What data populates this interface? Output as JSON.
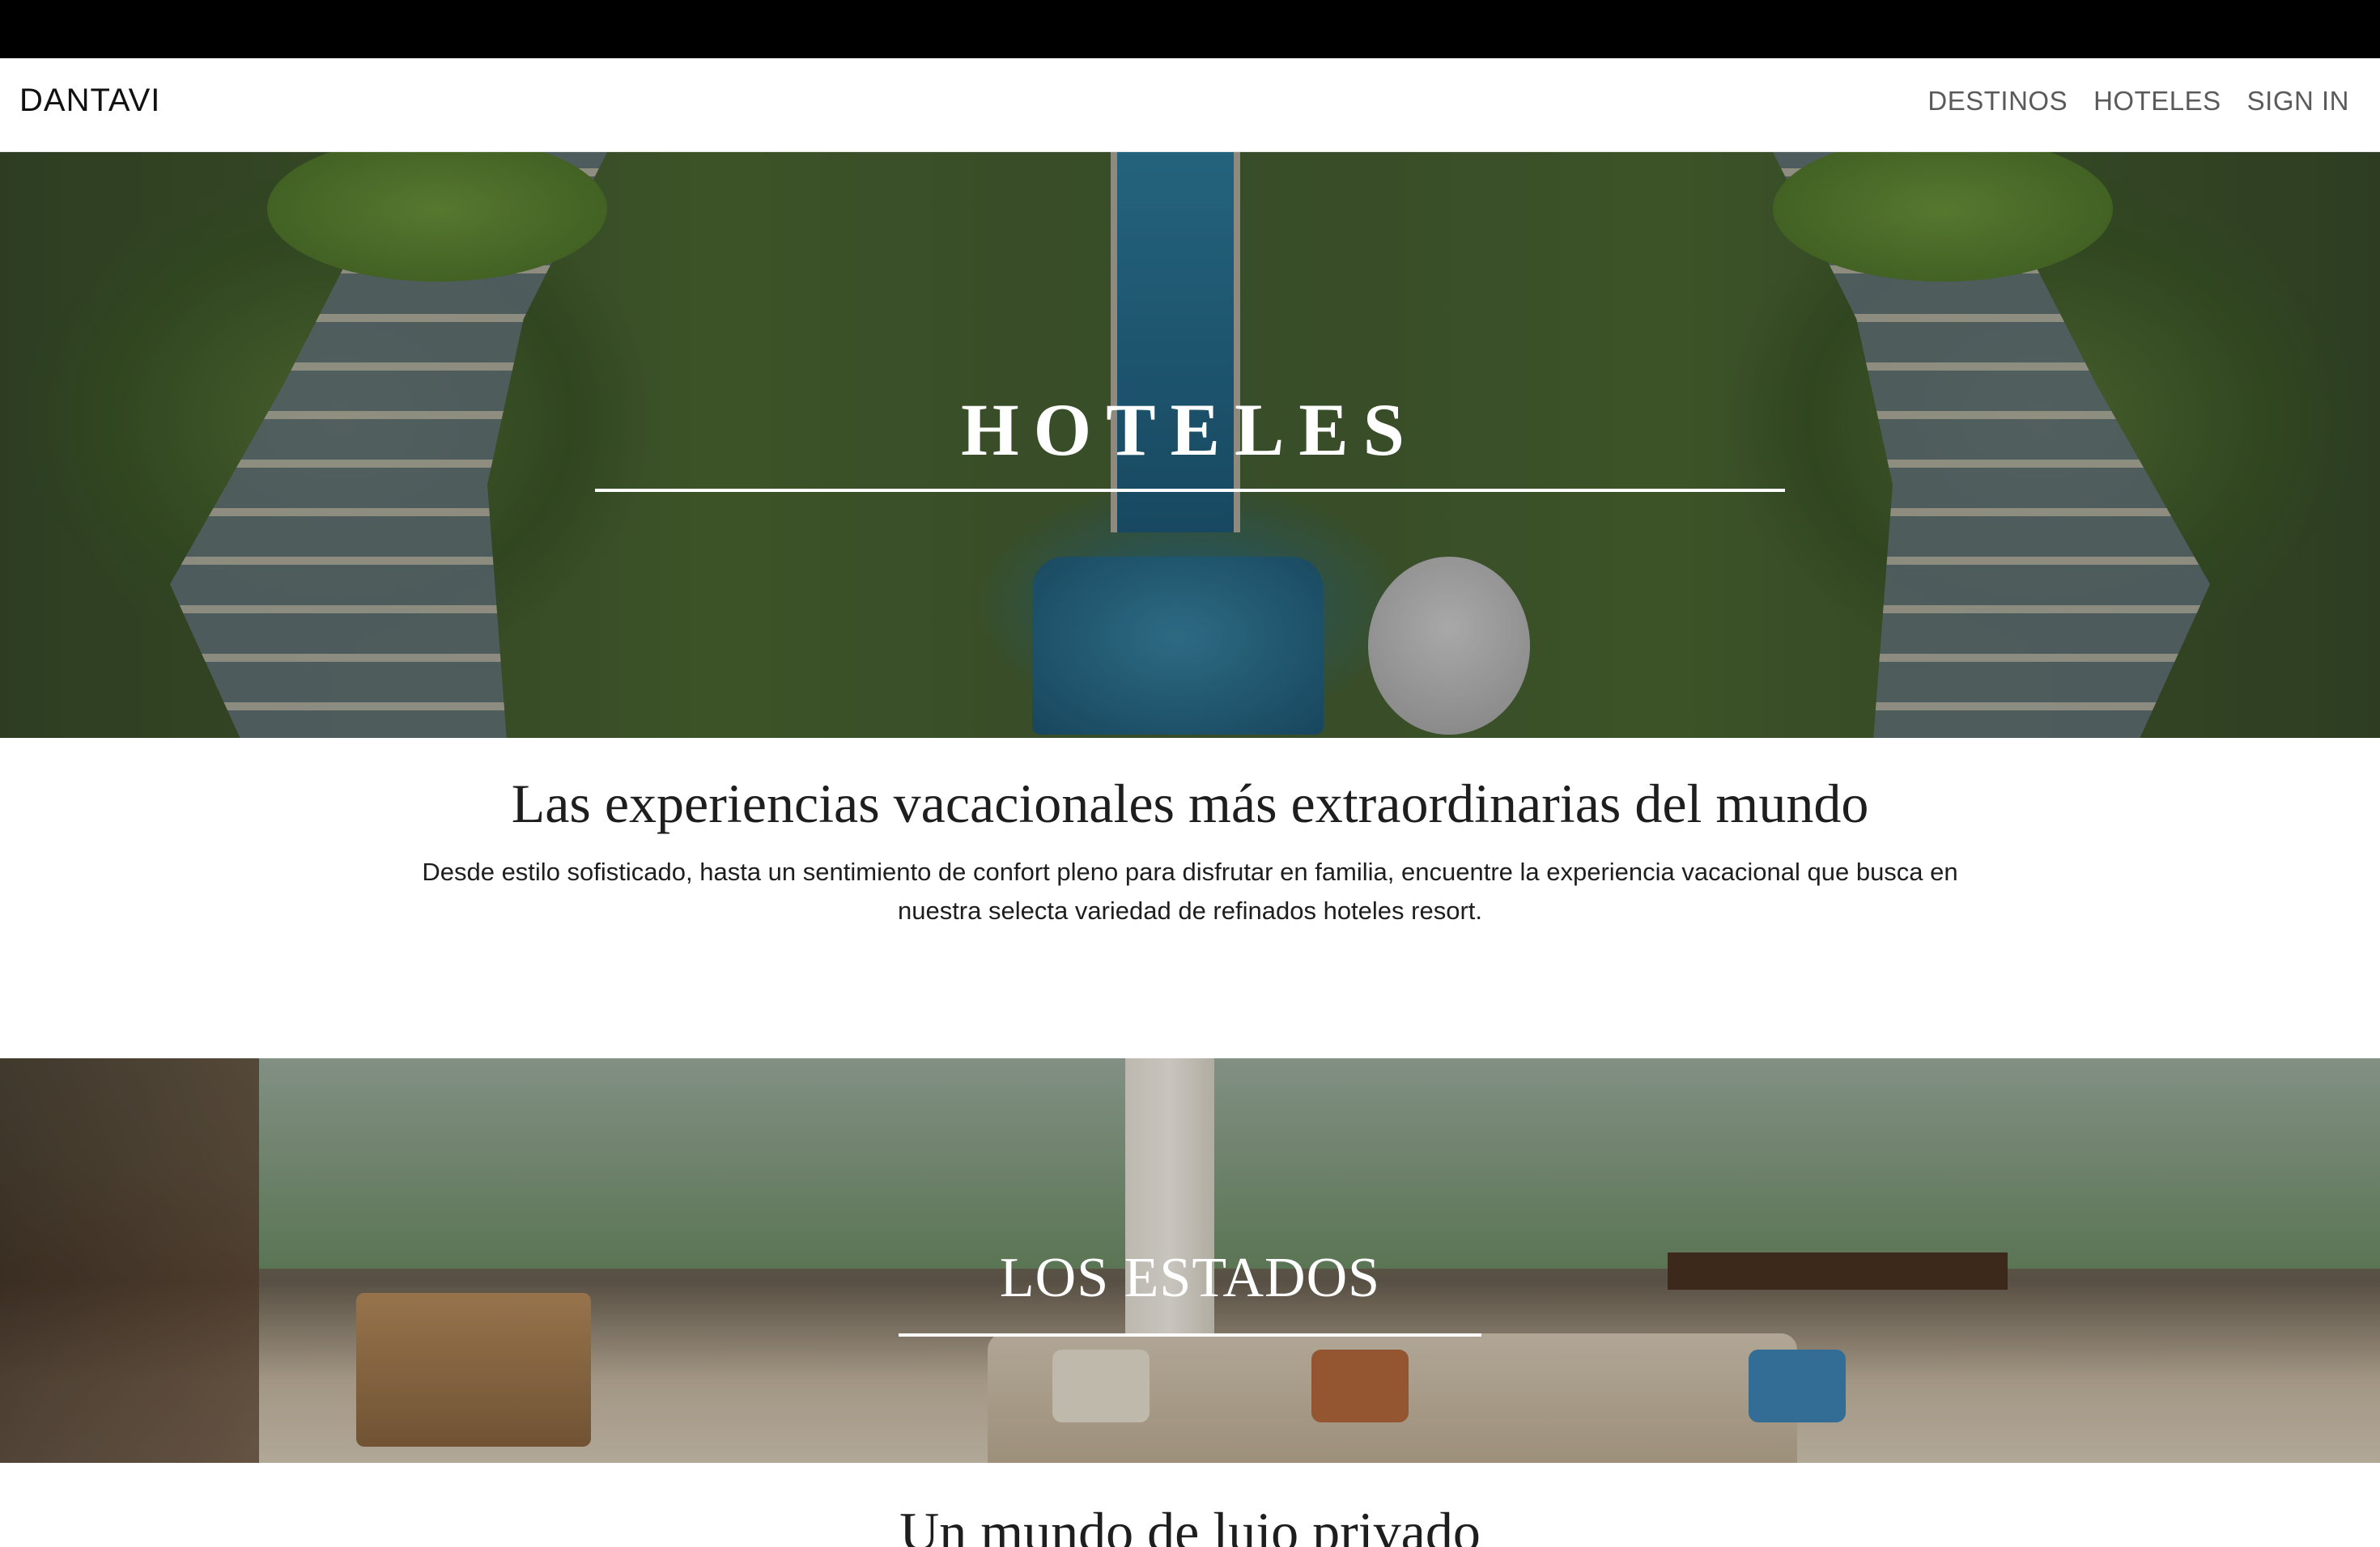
{
  "nav": {
    "brand": "DANTAVI",
    "links": [
      "DESTINOS",
      "HOTELES",
      "SIGN IN"
    ]
  },
  "hero": {
    "title": "HOTELES"
  },
  "intro": {
    "heading": "Las experiencias vacacionales más extraordinarias del mundo",
    "text": "Desde estilo sofisticado, hasta un sentimiento de confort pleno para disfrutar en familia, encuentre la experiencia vacacional que busca en nuestra selecta variedad de refinados hoteles resort."
  },
  "hero2": {
    "title": "LOS ESTADOS"
  },
  "section2": {
    "heading": "Un mundo de lujo privado"
  }
}
